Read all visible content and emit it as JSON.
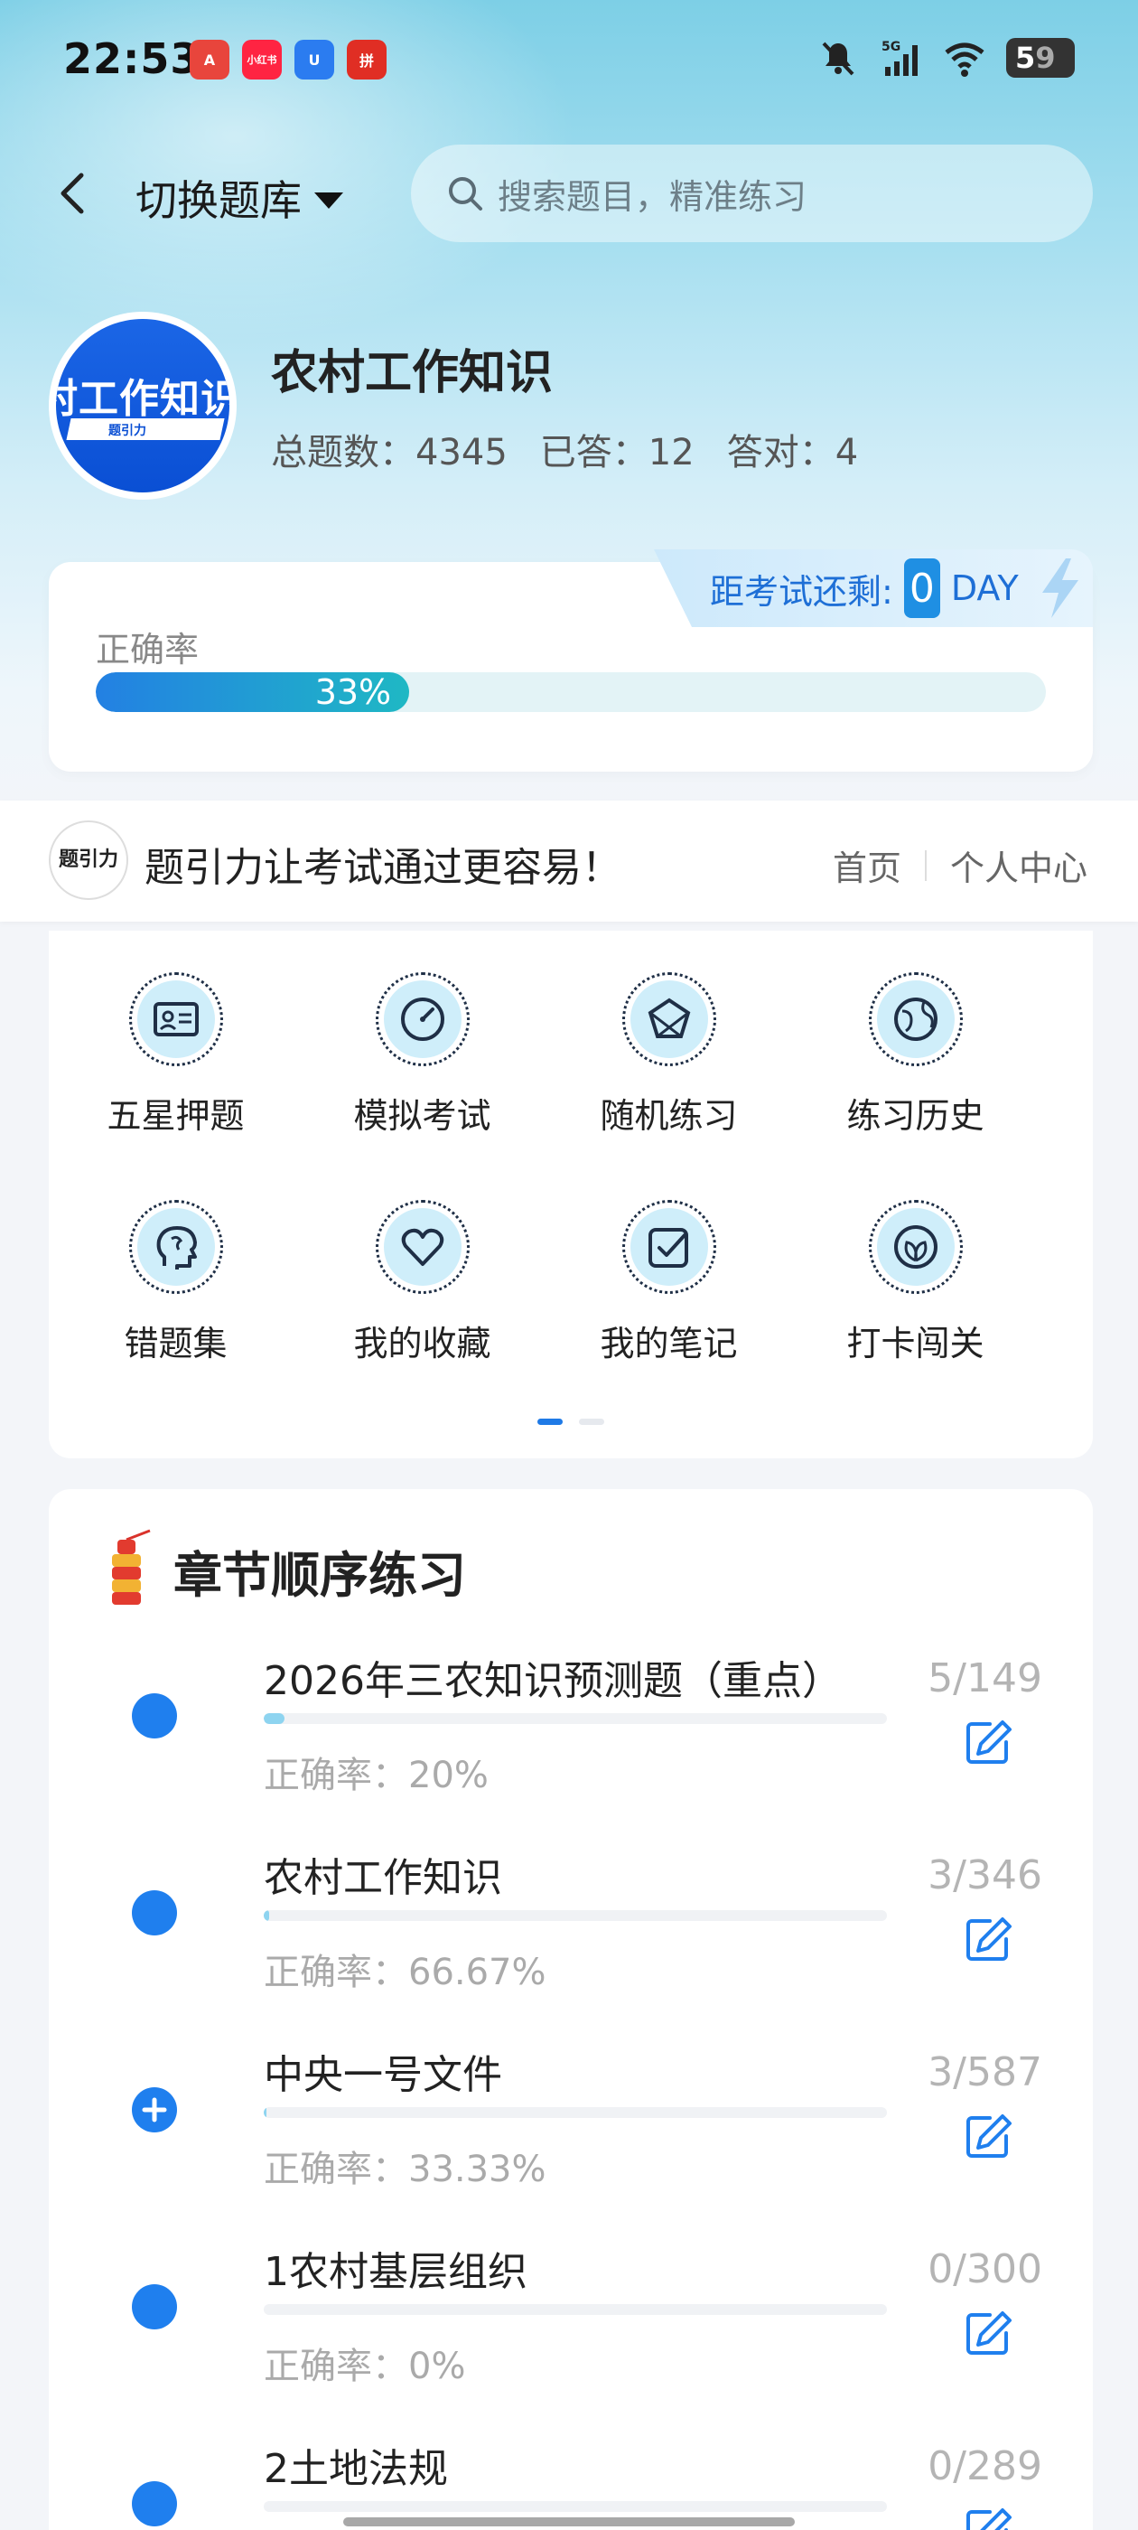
{
  "status_bar": {
    "time": "22:53",
    "battery": "5",
    "battery_rest": "9",
    "network": "5G",
    "apps": [
      {
        "name": "app-a-icon",
        "label": "A",
        "color": "#e8453c"
      },
      {
        "name": "app-xiaohongshu-icon",
        "label": "小红书",
        "color": "#ff2442"
      },
      {
        "name": "app-u-icon",
        "label": "U",
        "color": "#2b7cf0"
      },
      {
        "name": "app-pdd-icon",
        "label": "拼",
        "color": "#e02e24"
      }
    ]
  },
  "nav": {
    "switch_label": "切换题库",
    "search_placeholder": "搜索题目，精准练习"
  },
  "bank": {
    "logo_text": "村工作知识",
    "logo_sub": "题引力",
    "title": "农村工作知识",
    "total_label": "总题数：4345",
    "answered_label": "已答：12",
    "correct_label": "答对：4"
  },
  "exam": {
    "label": "距考试还剩:",
    "days": "0",
    "unit": "DAY"
  },
  "accuracy": {
    "label": "正确率",
    "value_text": "33%",
    "percent": 33
  },
  "banner": {
    "logo_text": "题引力",
    "slogan": "题引力让考试通过更容易！",
    "home_link": "首页",
    "profile_link": "个人中心"
  },
  "menu": [
    {
      "label": "五星押题",
      "icon": "id-card-icon"
    },
    {
      "label": "模拟考试",
      "icon": "speedometer-icon"
    },
    {
      "label": "随机练习",
      "icon": "network-icon"
    },
    {
      "label": "练习历史",
      "icon": "globe-icon"
    },
    {
      "label": "错题集",
      "icon": "head-icon"
    },
    {
      "label": "我的收藏",
      "icon": "heart-icon"
    },
    {
      "label": "我的笔记",
      "icon": "checkbox-icon"
    },
    {
      "label": "打卡闯关",
      "icon": "leaf-icon"
    }
  ],
  "chapters": {
    "title": "章节顺序练习",
    "items": [
      {
        "name": "2026年三农知识预测题（重点）",
        "count": "5/149",
        "accuracy": "正确率：20%",
        "progress": 0.034,
        "expandable": false
      },
      {
        "name": "农村工作知识",
        "count": "3/346",
        "accuracy": "正确率：66.67%",
        "progress": 0.009,
        "expandable": false
      },
      {
        "name": "中央一号文件",
        "count": "3/587",
        "accuracy": "正确率：33.33%",
        "progress": 0.005,
        "expandable": true
      },
      {
        "name": "1农村基层组织",
        "count": "0/300",
        "accuracy": "正确率：0%",
        "progress": 0,
        "expandable": false
      },
      {
        "name": "2土地法规",
        "count": "0/289",
        "accuracy": "",
        "progress": 0,
        "expandable": false
      }
    ]
  },
  "colors": {
    "accent": "#1f7fee",
    "progress_start": "#2380e3",
    "progress_end": "#1fb8c4"
  }
}
